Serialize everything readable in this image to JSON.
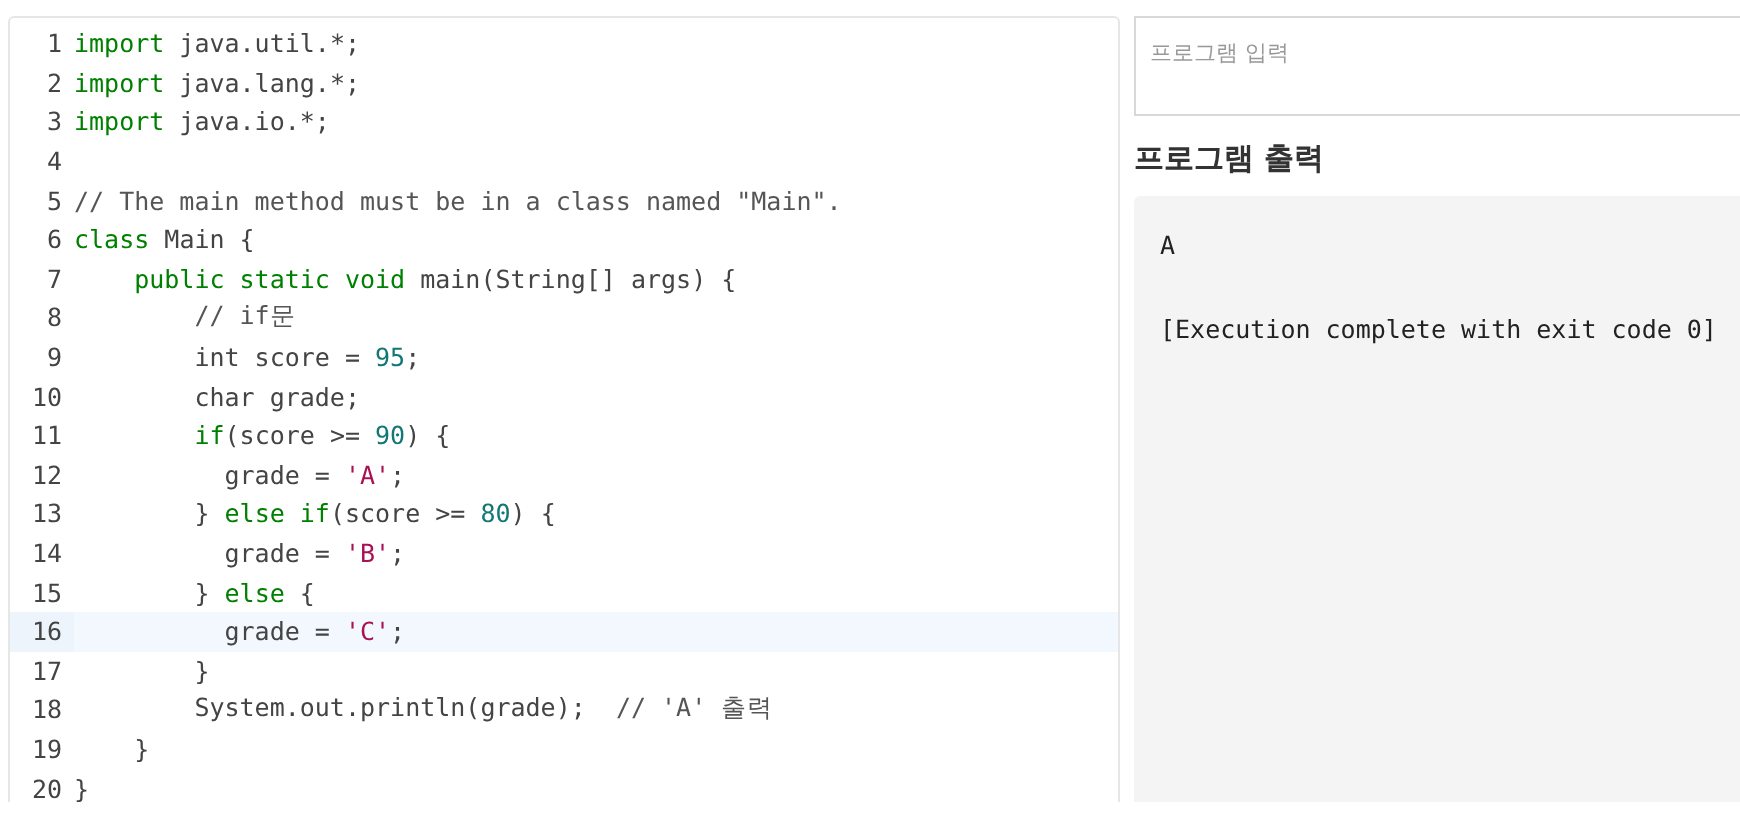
{
  "editor": {
    "lines": [
      {
        "number": "1",
        "selected": false,
        "tokens": [
          {
            "kind": "keyword",
            "text": "import"
          },
          {
            "kind": "plain",
            "text": " java.util.*;"
          }
        ]
      },
      {
        "number": "2",
        "selected": false,
        "tokens": [
          {
            "kind": "keyword",
            "text": "import"
          },
          {
            "kind": "plain",
            "text": " java.lang.*;"
          }
        ]
      },
      {
        "number": "3",
        "selected": false,
        "tokens": [
          {
            "kind": "keyword",
            "text": "import"
          },
          {
            "kind": "plain",
            "text": " java.io.*;"
          }
        ]
      },
      {
        "number": "4",
        "selected": false
      },
      {
        "number": "5",
        "selected": false,
        "tokens": [
          {
            "kind": "comment",
            "text": "// The main method must be in a class named \"Main\"."
          }
        ]
      },
      {
        "number": "6",
        "selected": false,
        "tokens": [
          {
            "kind": "keyword",
            "text": "class"
          },
          {
            "kind": "plain",
            "text": " Main {"
          }
        ]
      },
      {
        "number": "7",
        "selected": false,
        "tokens": [
          {
            "kind": "keyword",
            "text": "    public static void"
          },
          {
            "kind": "plain",
            "text": " main(String[] args) {"
          }
        ]
      },
      {
        "number": "8",
        "selected": false,
        "tokens": [
          {
            "kind": "comment",
            "text": "        // if문"
          }
        ]
      },
      {
        "number": "9",
        "selected": false,
        "tokens": [
          {
            "kind": "plain",
            "text": "        int score = "
          },
          {
            "kind": "number",
            "text": "95"
          },
          {
            "kind": "plain",
            "text": ";"
          }
        ]
      },
      {
        "number": "10",
        "selected": false,
        "tokens": [
          {
            "kind": "plain",
            "text": "        char grade;"
          }
        ]
      },
      {
        "number": "11",
        "selected": false,
        "tokens": [
          {
            "kind": "keyword",
            "text": "        if"
          },
          {
            "kind": "plain",
            "text": "(score >= "
          },
          {
            "kind": "number",
            "text": "90"
          },
          {
            "kind": "plain",
            "text": ") {"
          }
        ]
      },
      {
        "number": "12",
        "selected": false,
        "tokens": [
          {
            "kind": "plain",
            "text": "          grade = "
          },
          {
            "kind": "string",
            "text": "'A'"
          },
          {
            "kind": "plain",
            "text": ";"
          }
        ]
      },
      {
        "number": "13",
        "selected": false,
        "tokens": [
          {
            "kind": "plain",
            "text": "        } "
          },
          {
            "kind": "keyword",
            "text": "else if"
          },
          {
            "kind": "plain",
            "text": "(score >= "
          },
          {
            "kind": "number",
            "text": "80"
          },
          {
            "kind": "plain",
            "text": ") {"
          }
        ]
      },
      {
        "number": "14",
        "selected": false,
        "tokens": [
          {
            "kind": "plain",
            "text": "          grade = "
          },
          {
            "kind": "string",
            "text": "'B'"
          },
          {
            "kind": "plain",
            "text": ";"
          }
        ]
      },
      {
        "number": "15",
        "selected": false,
        "tokens": [
          {
            "kind": "plain",
            "text": "        } "
          },
          {
            "kind": "keyword",
            "text": "else"
          },
          {
            "kind": "plain",
            "text": " {"
          }
        ]
      },
      {
        "number": "16",
        "selected": true,
        "tokens": [
          {
            "kind": "plain",
            "text": "          grade = "
          },
          {
            "kind": "string",
            "text": "'C'"
          },
          {
            "kind": "plain",
            "text": ";"
          }
        ]
      },
      {
        "number": "17",
        "selected": false,
        "tokens": [
          {
            "kind": "plain",
            "text": "        }"
          }
        ]
      },
      {
        "number": "18",
        "selected": false,
        "tokens": [
          {
            "kind": "plain",
            "text": "        System.out.println(grade);  "
          },
          {
            "kind": "comment",
            "text": "// 'A' 출력"
          }
        ]
      },
      {
        "number": "19",
        "selected": false,
        "tokens": [
          {
            "kind": "plain",
            "text": "    }"
          }
        ]
      },
      {
        "number": "20",
        "selected": false,
        "tokens": [
          {
            "kind": "plain",
            "text": "}"
          }
        ]
      }
    ]
  },
  "input": {
    "placeholder": "프로그램 입력"
  },
  "output": {
    "heading": "프로그램 출력",
    "lines": [
      "A",
      "[Execution complete with exit code 0]"
    ]
  }
}
